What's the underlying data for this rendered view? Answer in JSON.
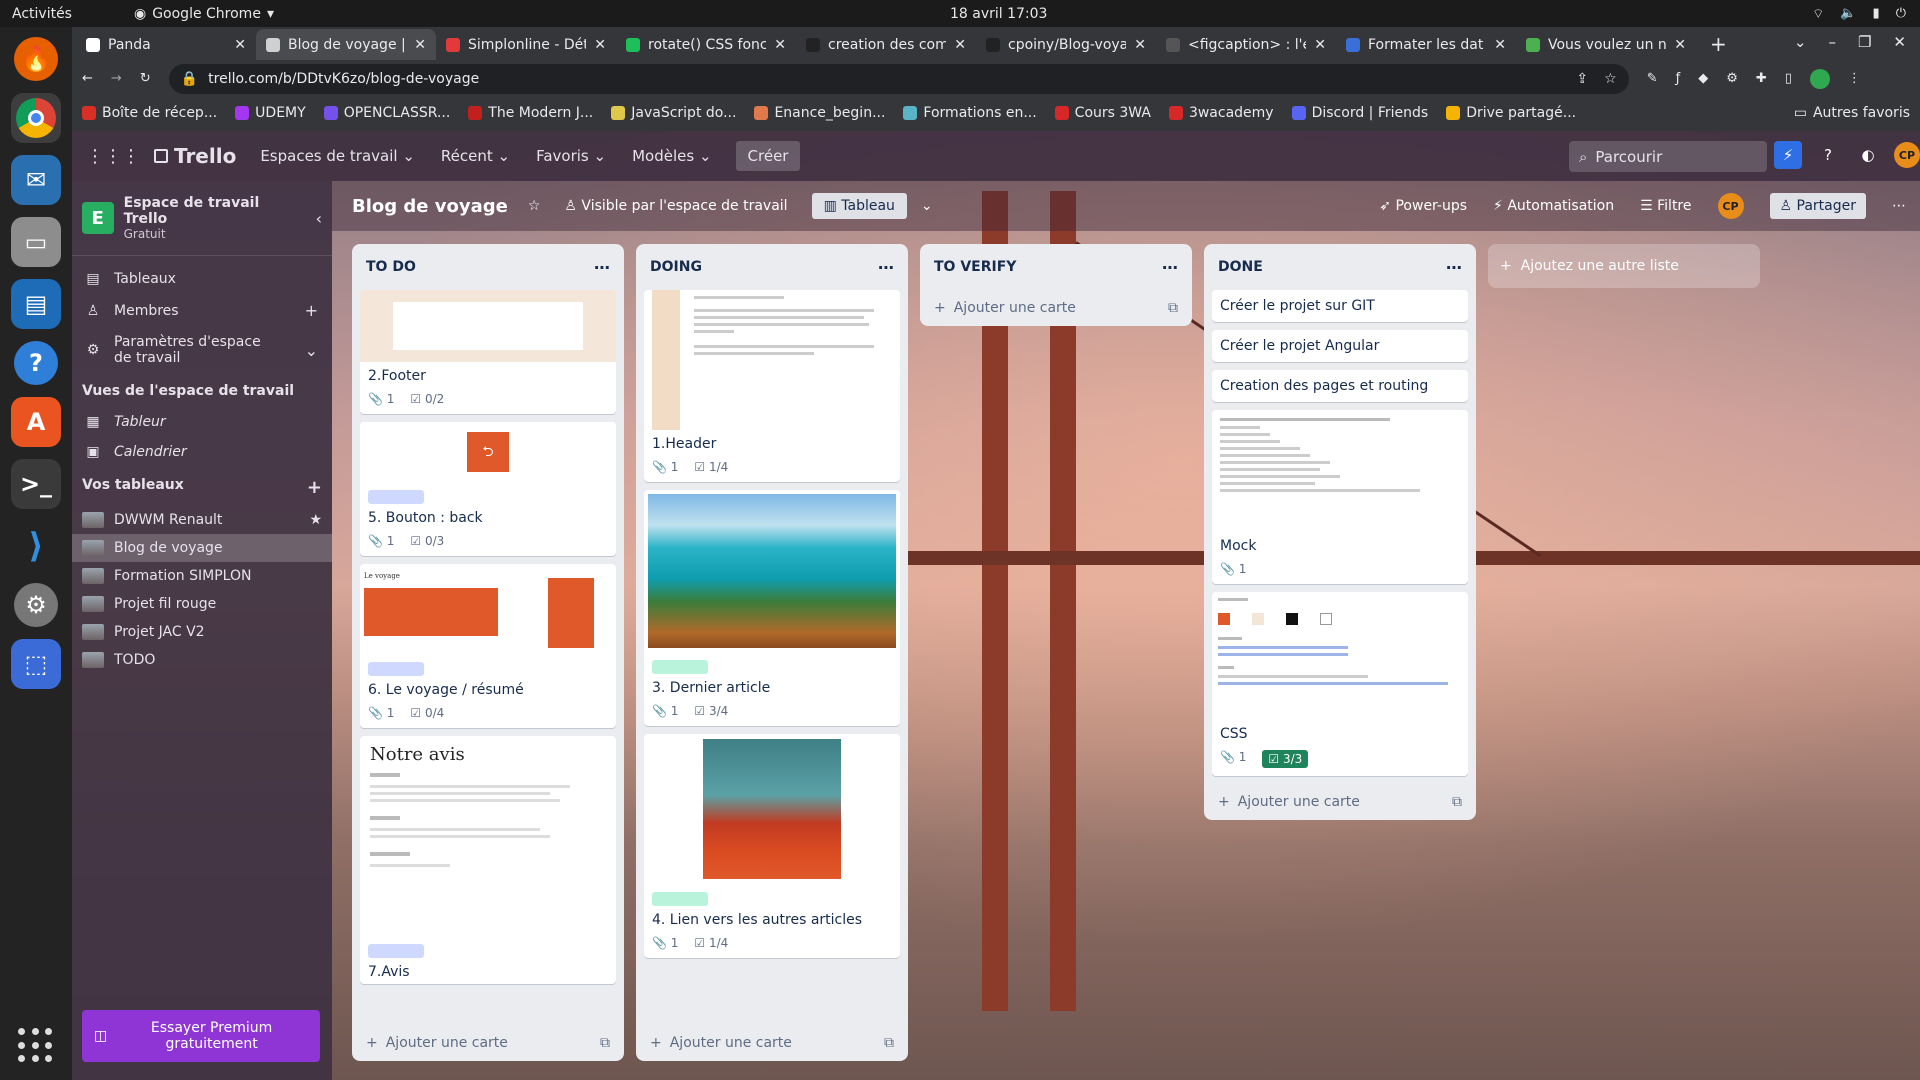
{
  "os": {
    "activities": "Activités",
    "app": "Google Chrome",
    "clock": "18 avril  17:03"
  },
  "chrome": {
    "tabs": [
      {
        "label": "Panda",
        "color": "#ffffff"
      },
      {
        "label": "Blog de voyage |",
        "color": "#d0d0d0"
      },
      {
        "label": "Simplonline - Dét",
        "color": "#e23a3a"
      },
      {
        "label": "rotate() CSS fonc",
        "color": "#1dbf5a"
      },
      {
        "label": "creation des com",
        "color": "#222222"
      },
      {
        "label": "cpoiny/Blog-voya",
        "color": "#222222"
      },
      {
        "label": "<figcaption> : l'é",
        "color": "#555555"
      },
      {
        "label": "Formater les dat",
        "color": "#3a6fd8"
      },
      {
        "label": "Vous voulez un n",
        "color": "#4caf50"
      }
    ],
    "url": "trello.com/b/DDtvK6zo/blog-de-voyage",
    "bookmarks": [
      {
        "label": "Boîte de récep...",
        "color": "#d93025"
      },
      {
        "label": "UDEMY",
        "color": "#a435f0"
      },
      {
        "label": "OPENCLASSR...",
        "color": "#7451eb"
      },
      {
        "label": "The Modern J...",
        "color": "#c21f1f"
      },
      {
        "label": "JavaScript do...",
        "color": "#e0c84a"
      },
      {
        "label": "Enance_begin...",
        "color": "#e07a4a"
      },
      {
        "label": "Formations en...",
        "color": "#5ab4c8"
      },
      {
        "label": "Cours 3WA",
        "color": "#d62828"
      },
      {
        "label": "3wacademy",
        "color": "#d62828"
      },
      {
        "label": "Discord | Friends",
        "color": "#5865f2"
      },
      {
        "label": "Drive partagé...",
        "color": "#f4b400"
      }
    ],
    "other_bookmarks": "Autres favoris"
  },
  "trello": {
    "logo": "Trello",
    "nav": [
      "Espaces de travail",
      "Récent",
      "Favoris",
      "Modèles"
    ],
    "create": "Créer",
    "search_placeholder": "Parcourir",
    "avatar": "CP"
  },
  "sidebar": {
    "workspace_title": "Espace de travail Trello",
    "workspace_plan": "Gratuit",
    "workspace_initial": "E",
    "items": [
      {
        "label": "Tableaux"
      },
      {
        "label": "Membres"
      },
      {
        "label": "Paramètres d'espace de travail"
      }
    ],
    "views_title": "Vues de l'espace de travail",
    "views": [
      "Tableur",
      "Calendrier"
    ],
    "boards_title": "Vos tableaux",
    "boards": [
      "DWWM Renault",
      "Blog de voyage",
      "Formation SIMPLON",
      "Projet fil rouge",
      "Projet JAC V2",
      "TODO"
    ],
    "premium": "Essayer Premium gratuitement"
  },
  "board": {
    "title": "Blog de voyage",
    "visibility": "Visible par l'espace de travail",
    "view": "Tableau",
    "powerups": "Power-ups",
    "automation": "Automatisation",
    "filter": "Filtre",
    "share": "Partager",
    "add_list": "Ajoutez une autre liste",
    "add_card": "Ajouter une carte"
  },
  "lists": [
    {
      "title": "TO DO",
      "cards": [
        {
          "title": "2.Footer",
          "attachments": "1",
          "checklist": "0/2"
        },
        {
          "title": "5. Bouton : back",
          "attachments": "1",
          "checklist": "0/3"
        },
        {
          "title": "6. Le voyage / résumé",
          "attachments": "1",
          "checklist": "0/4"
        },
        {
          "title": "7.Avis"
        }
      ]
    },
    {
      "title": "DOING",
      "cards": [
        {
          "title": "1.Header",
          "attachments": "1",
          "checklist": "1/4"
        },
        {
          "title": "3. Dernier article",
          "attachments": "1",
          "checklist": "3/4"
        },
        {
          "title": "4. Lien vers les autres articles",
          "attachments": "1",
          "checklist": "1/4"
        }
      ]
    },
    {
      "title": "TO VERIFY",
      "cards": []
    },
    {
      "title": "DONE",
      "cards": [
        {
          "title": "Créer le projet sur GIT"
        },
        {
          "title": "Créer le projet Angular"
        },
        {
          "title": "Creation des pages et routing"
        },
        {
          "title": "Mock",
          "attachments": "1"
        },
        {
          "title": "CSS",
          "attachments": "1",
          "checklist": "3/3"
        }
      ]
    }
  ]
}
